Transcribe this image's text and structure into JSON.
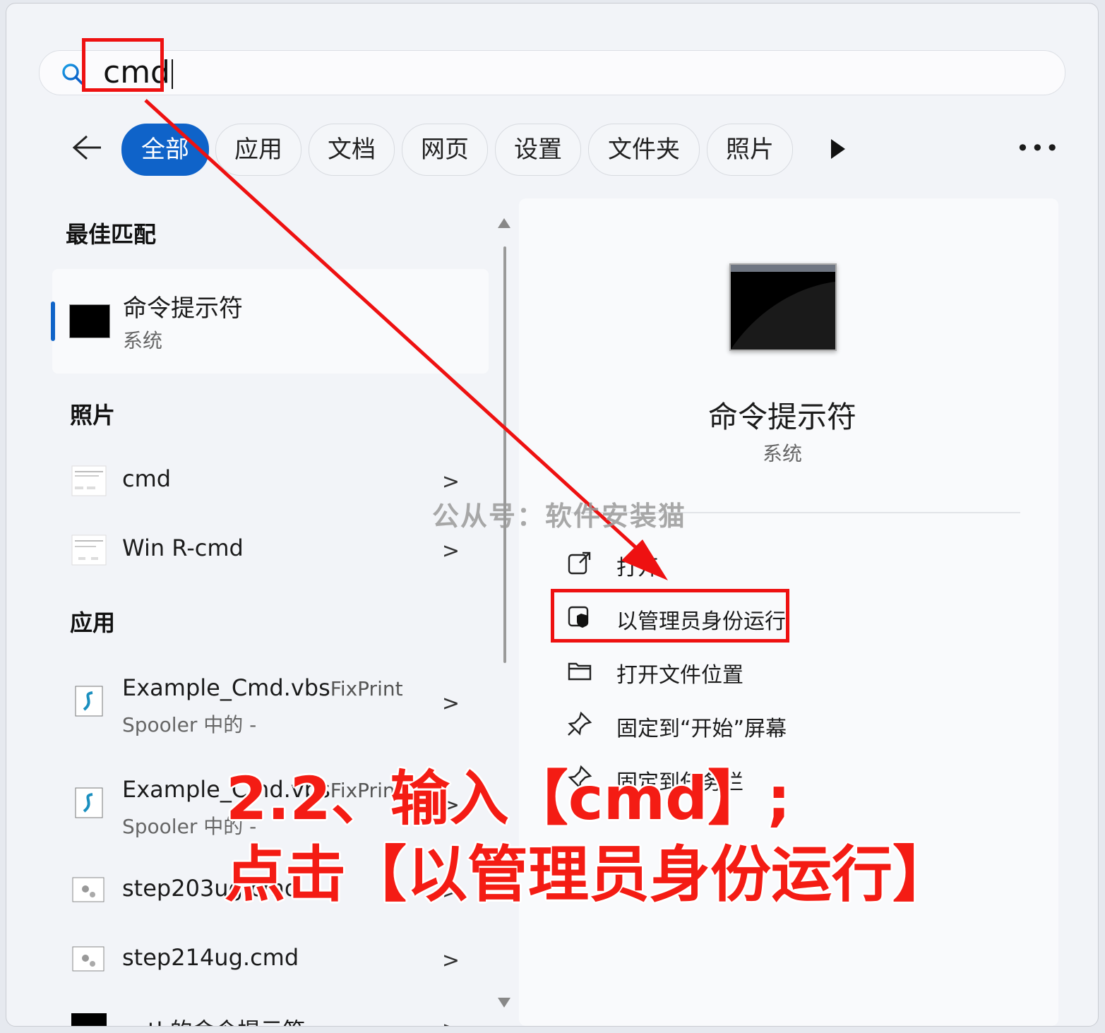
{
  "search": {
    "query": "cmd"
  },
  "tabs": [
    "全部",
    "应用",
    "文档",
    "网页",
    "设置",
    "文件夹",
    "照片"
  ],
  "sections": {
    "best": "最佳匹配",
    "photos": "照片",
    "apps": "应用"
  },
  "best_match": {
    "title": "命令提示符",
    "subtitle": "系统"
  },
  "photos": [
    {
      "label": "cmd"
    },
    {
      "label": "Win R-cmd"
    }
  ],
  "apps": [
    {
      "label": "Example_Cmd.vbs",
      "label_suffix": "FixPrint",
      "sub": "Spooler 中的 -"
    },
    {
      "label": "Example_Cmd.vbs",
      "label_suffix": "FixPrint",
      "sub": "Spooler 中的 -"
    },
    {
      "label": "step203ug.cmd"
    },
    {
      "label": "step214ug.cmd"
    },
    {
      "label": "xctl 的命令提示符"
    }
  ],
  "preview": {
    "title": "命令提示符",
    "subtitle": "系统",
    "actions": [
      "打开",
      "以管理员身份运行",
      "打开文件位置",
      "固定到“开始”屏幕",
      "固定到任务栏"
    ]
  },
  "watermark": "公从号：软件安装猫",
  "annotation": {
    "line1": "2.2、输入【cmd】;",
    "line2": "点击【以管理员身份运行】"
  },
  "colors": {
    "accent": "#0f63c9",
    "highlight": "#ee1111",
    "annotation": "#f41c14"
  },
  "icons": {
    "search": "search-icon",
    "back": "arrow-left-icon",
    "more": "more-icon",
    "open": "open-external-icon",
    "admin": "shield-icon",
    "folder": "folder-icon",
    "pin": "pin-icon"
  }
}
